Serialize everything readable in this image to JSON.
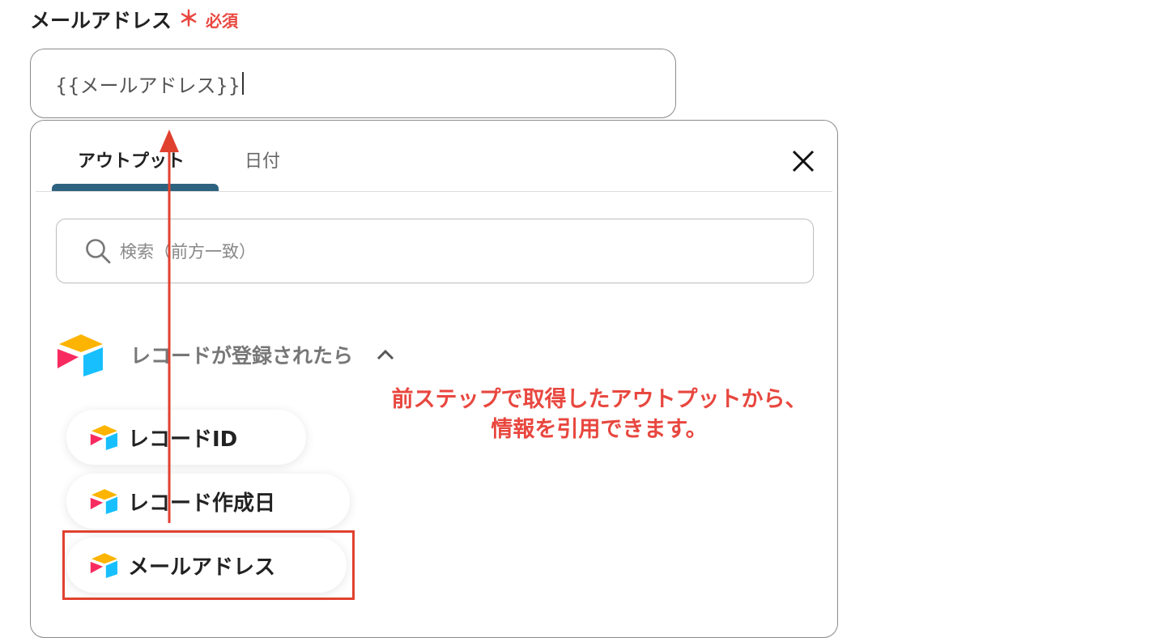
{
  "field": {
    "label": "メールアドレス",
    "required_mark": "＊",
    "required_text": "必須",
    "value": "{{メールアドレス}}"
  },
  "popover": {
    "tabs": [
      {
        "label": "アウトプット",
        "active": true
      },
      {
        "label": "日付",
        "active": false
      }
    ],
    "close_icon": "close-icon",
    "search": {
      "placeholder": "検索（前方一致）",
      "icon": "search-icon"
    },
    "group": {
      "title": "レコードが登録されたら",
      "icon": "airtable-logo-icon",
      "expanded": true
    },
    "items": [
      {
        "label": "レコードID"
      },
      {
        "label": "レコード作成日"
      },
      {
        "label": "メールアドレス"
      }
    ]
  },
  "annotation": {
    "line1": "前ステップで取得したアウトプットから、",
    "line2": "情報を引用できます。"
  },
  "colors": {
    "accent_red": "#e8473f",
    "tab_underline": "#2d6380"
  }
}
